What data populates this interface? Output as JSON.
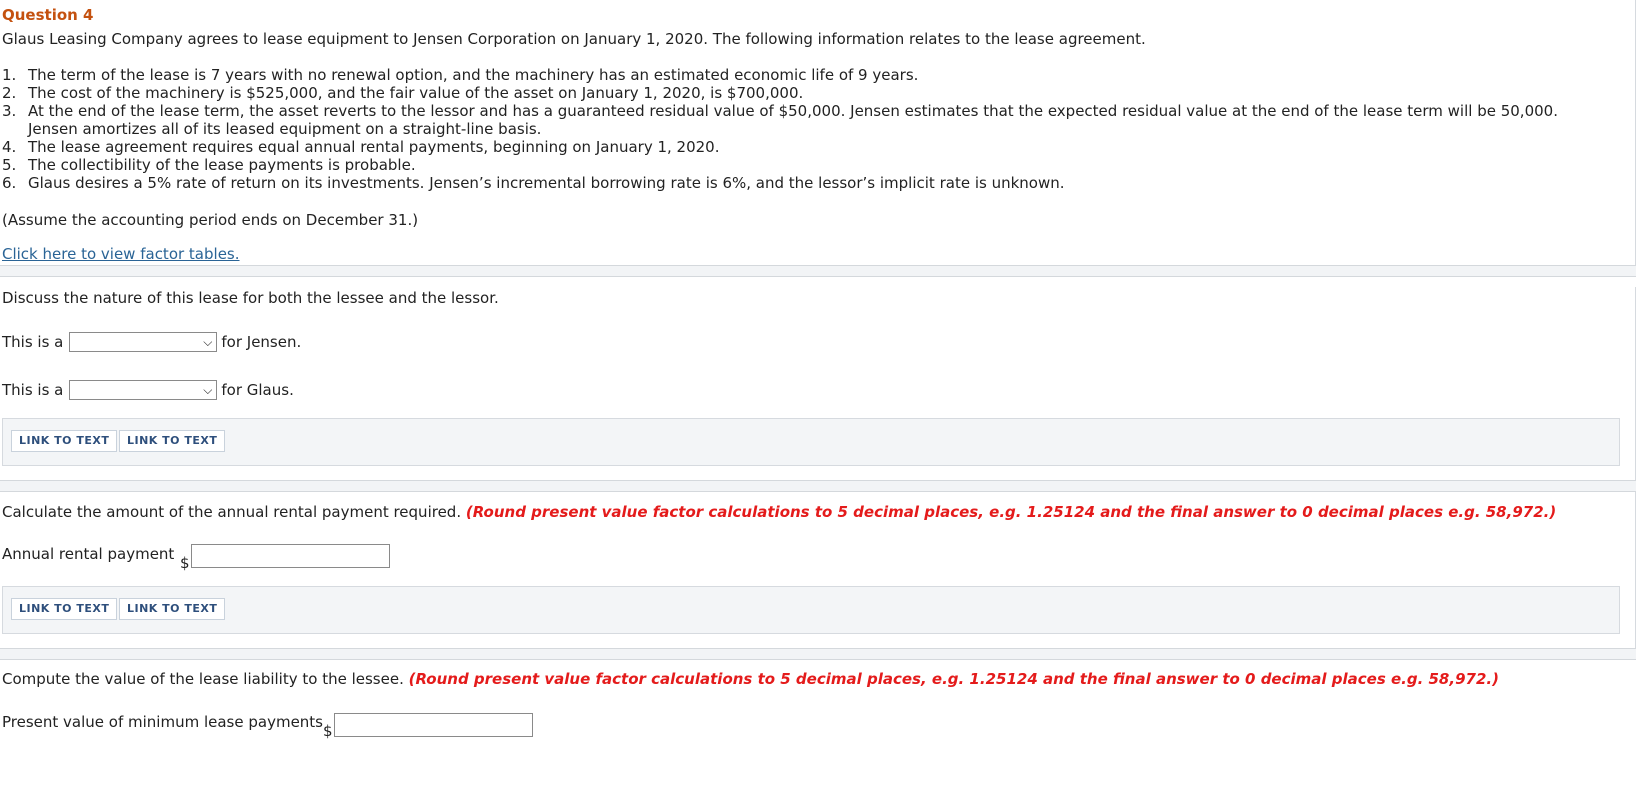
{
  "question": {
    "title": "Question 4",
    "intro": "Glaus Leasing Company agrees to lease equipment to Jensen Corporation on January 1, 2020. The following information relates to the lease agreement.",
    "items": [
      {
        "num": "1.",
        "text": "The term of the lease is 7 years with no renewal option, and the machinery has an estimated economic life of 9 years."
      },
      {
        "num": "2.",
        "text": "The cost of the machinery is $525,000, and the fair value of the asset on January 1, 2020, is $700,000."
      },
      {
        "num": "3.",
        "text": "At the end of the lease term, the asset reverts to the lessor and has a guaranteed residual value of $50,000. Jensen estimates that the expected residual value at the end of the lease term will be 50,000. Jensen amortizes all of its leased equipment on a straight-line basis."
      },
      {
        "num": "4.",
        "text": "The lease agreement requires equal annual rental payments, beginning on January 1, 2020."
      },
      {
        "num": "5.",
        "text": "The collectibility of the lease payments is probable."
      },
      {
        "num": "6.",
        "text": "Glaus desires a 5% rate of return on its investments. Jensen’s incremental borrowing rate is 6%, and the lessor’s implicit rate is unknown."
      }
    ],
    "assume": "(Assume the accounting period ends on December 31.)",
    "factor_link": "Click here to view factor tables."
  },
  "part1": {
    "prompt": "Discuss the nature of this lease for both the lessee and the lessor.",
    "row1_prefix": "This is a",
    "row1_suffix": "for Jensen.",
    "row1_value": "",
    "row2_prefix": "This is a",
    "row2_suffix": "for Glaus.",
    "row2_value": "",
    "link1": "LINK TO TEXT",
    "link2": "LINK TO TEXT"
  },
  "part2": {
    "prompt": "Calculate the amount of the annual rental payment required.",
    "instruction": "(Round present value factor calculations to 5 decimal places, e.g. 1.25124 and the final answer to 0 decimal places e.g. 58,972.)",
    "label": "Annual rental payment",
    "currency": "$",
    "value": "",
    "link1": "LINK TO TEXT",
    "link2": "LINK TO TEXT"
  },
  "part3": {
    "prompt": "Compute the value of the lease liability to the lessee.",
    "instruction": "(Round present value factor calculations to 5 decimal places, e.g. 1.25124 and the final answer to 0 decimal places e.g. 58,972.)",
    "label": "Present value of minimum lease payments",
    "currency": "$",
    "value": ""
  },
  "colors": {
    "title": "#c4510f",
    "instruction": "#e41b1b",
    "link": "#2a6496"
  },
  "icons": {
    "select_arrow": "chevron-down-icon"
  }
}
